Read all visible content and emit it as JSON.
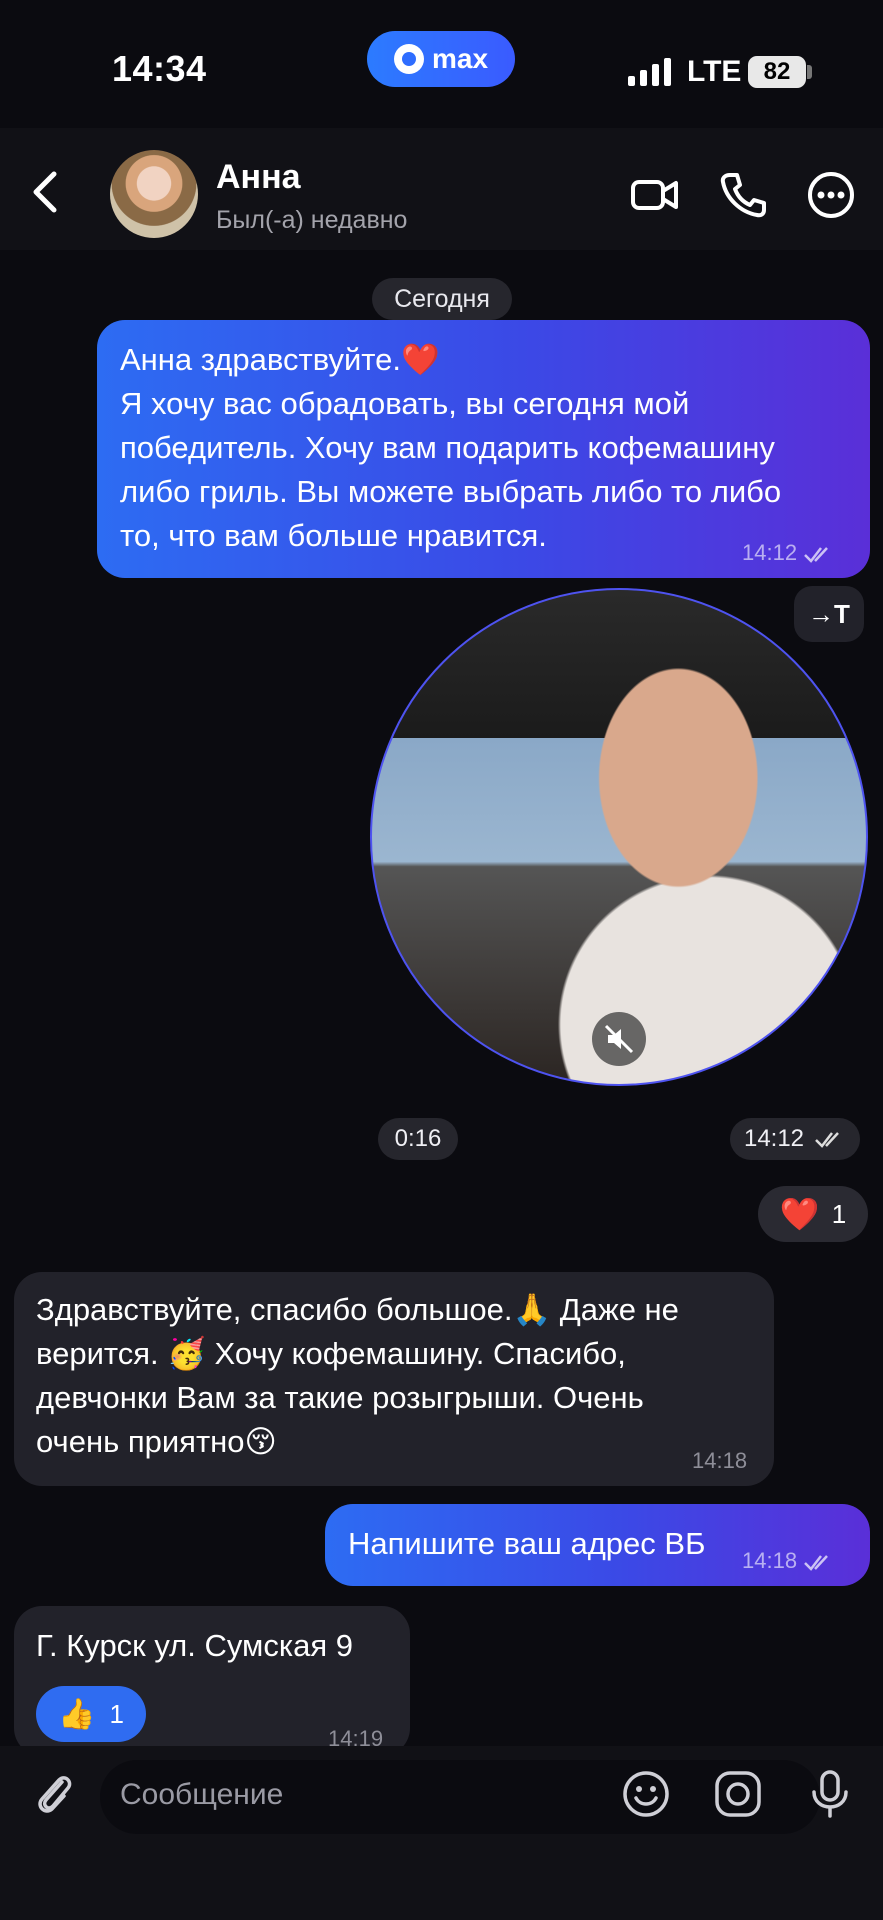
{
  "status_bar": {
    "time": "14:34",
    "app_badge": "max",
    "network": "LTE",
    "battery": "82"
  },
  "header": {
    "contact_name": "Анна",
    "contact_status": "Был(-а) недавно",
    "icons": [
      "back-icon",
      "video-call-icon",
      "phone-icon",
      "more-icon"
    ]
  },
  "chat": {
    "date_label": "Сегодня",
    "messages": [
      {
        "direction": "outgoing",
        "lines": [
          "Анна здравствуйте.❤️",
          "Я хочу вас обрадовать, вы сегодня мой",
          "победитель. Хочу вам подарить кофемашину",
          "либо гриль. Вы можете выбрать либо то либо",
          "то, что вам больше нравится."
        ],
        "time": "14:12"
      },
      {
        "direction": "outgoing",
        "type": "video-note",
        "duration": "0:16",
        "time": "14:12",
        "translate_label": "→T",
        "reaction": {
          "emoji": "❤️",
          "count": "1"
        }
      },
      {
        "direction": "incoming",
        "lines": [
          "Здравствуйте, спасибо большое.🙏 Даже не",
          "верится. 🥳 Хочу кофемашину. Спасибо,",
          "девчонки Вам за такие розыгрыши. Очень",
          "очень приятно😚"
        ],
        "time": "14:18"
      },
      {
        "direction": "outgoing",
        "lines": [
          "Напишите ваш адрес ВБ"
        ],
        "time": "14:18"
      },
      {
        "direction": "incoming",
        "lines": [
          "Г. Курск ул. Сумская 9"
        ],
        "time": "14:19",
        "reaction": {
          "emoji": "👍",
          "count": "1"
        }
      }
    ]
  },
  "composer": {
    "placeholder": "Сообщение",
    "icons": [
      "attach-icon",
      "emoji-icon",
      "sticker-icon",
      "microphone-icon"
    ]
  },
  "colors": {
    "background": "#0b0b10",
    "outgoing_start": "#2d6cf3",
    "outgoing_end": "#5a2fd8",
    "incoming": "#22222a",
    "accent": "#2f6cf1"
  }
}
